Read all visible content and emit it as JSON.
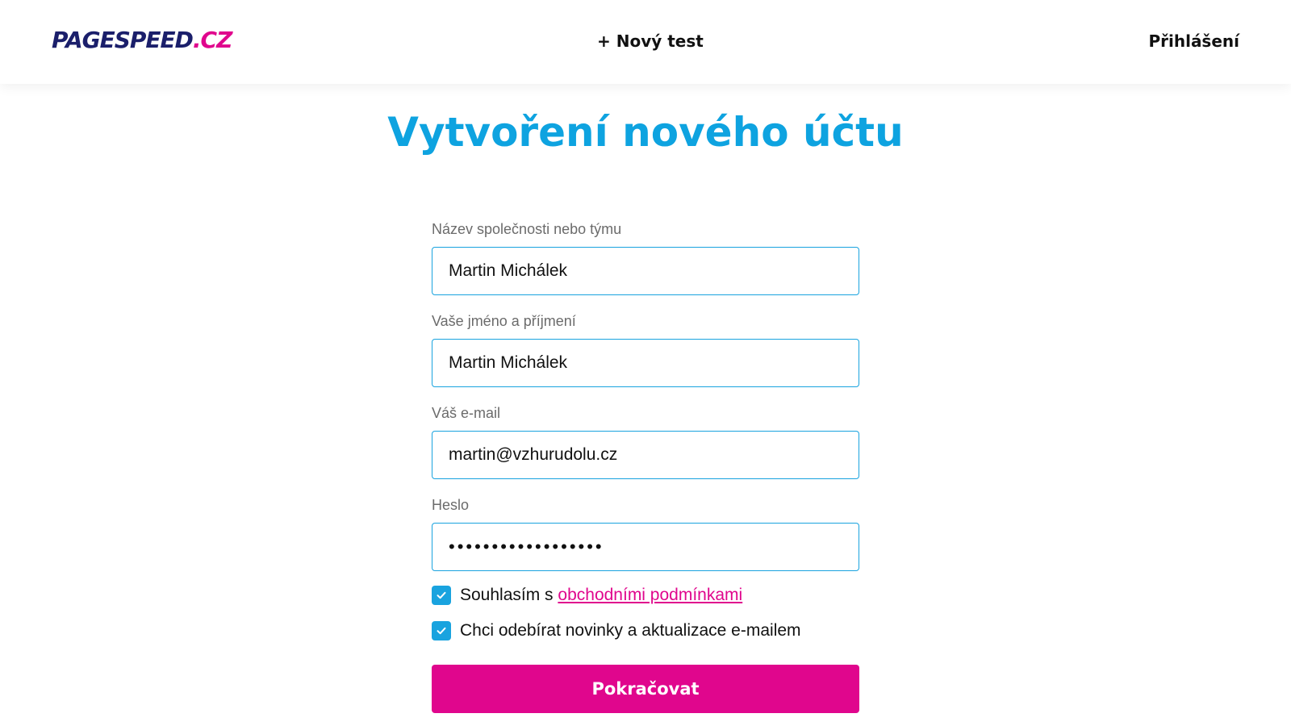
{
  "header": {
    "logo_main": "PAGESPEED",
    "logo_tld": ".CZ",
    "new_test_label": "+ Nový test",
    "login_label": "Přihlášení"
  },
  "page": {
    "title": "Vytvoření nového účtu"
  },
  "form": {
    "company": {
      "label": "Název společnosti nebo týmu",
      "value": "Martin Michálek"
    },
    "fullname": {
      "label": "Vaše jméno a příjmení",
      "value": "Martin Michálek"
    },
    "email": {
      "label": "Váš e-mail",
      "value": "martin@vzhurudolu.cz"
    },
    "password": {
      "label": "Heslo",
      "value": "••••••••••••••••••"
    },
    "terms": {
      "checked": true,
      "prefix": "Souhlasím s",
      "link_text": "obchodními podmínkami"
    },
    "newsletter": {
      "checked": true,
      "label": "Chci odebírat novinky a aktualizace e-mailem"
    },
    "submit_label": "Pokračovat"
  },
  "colors": {
    "brand_dark": "#1b1f6b",
    "brand_pink": "#e0068d",
    "accent_blue": "#0ea3e0"
  },
  "icons": {
    "checkbox_check": "check-icon"
  }
}
